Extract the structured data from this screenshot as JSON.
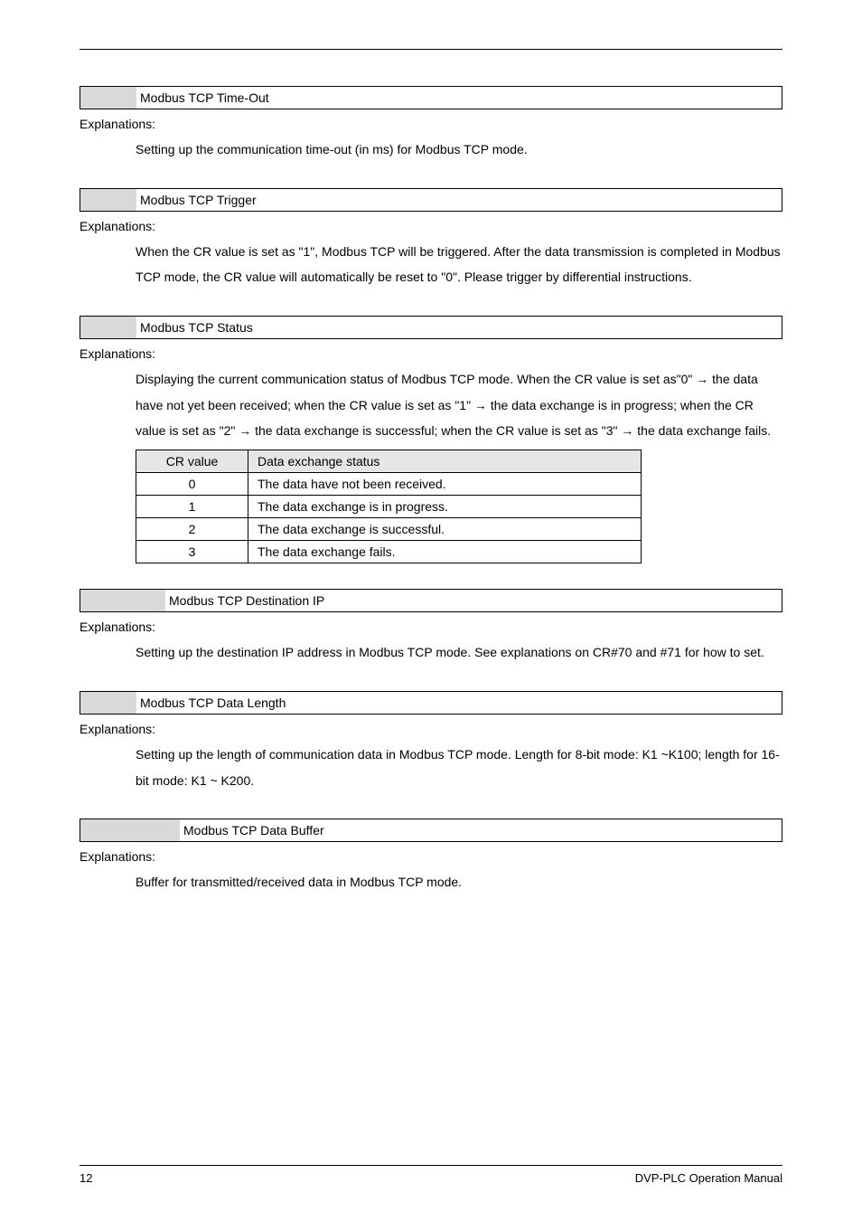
{
  "sections": {
    "timeout": {
      "title": "Modbus TCP Time-Out",
      "label": "Explanations:",
      "body": "Setting up the communication time-out (in ms) for Modbus TCP mode."
    },
    "trigger": {
      "title": "Modbus TCP Trigger",
      "label": "Explanations:",
      "body": "When the CR value is set as \"1\", Modbus TCP will be triggered. After the data transmission is completed in Modbus TCP mode, the CR value will automatically be reset to \"0\". Please trigger by differential instructions."
    },
    "status": {
      "title": "Modbus TCP Status",
      "label": "Explanations:",
      "body": "Displaying the current communication status of Modbus TCP mode. When the CR value is set as\"0\" → the data have not yet been received; when the CR value is set as \"1\" → the data exchange is in progress; when the CR value is set as \"2\" → the data exchange is successful; when the CR value is set as \"3\" → the data exchange fails.",
      "table": {
        "head_cr": "CR value",
        "head_status": "Data exchange status",
        "rows": [
          {
            "cr": "0",
            "status": "The data have not been received."
          },
          {
            "cr": "1",
            "status": "The data exchange is in progress."
          },
          {
            "cr": "2",
            "status": "The data exchange is successful."
          },
          {
            "cr": "3",
            "status": "The data exchange fails."
          }
        ]
      }
    },
    "destip": {
      "title": "Modbus TCP Destination IP",
      "label": "Explanations:",
      "body": "Setting up the destination IP address in Modbus TCP mode. See explanations on CR#70 and #71 for how to set."
    },
    "datalen": {
      "title": "Modbus TCP Data Length",
      "label": "Explanations:",
      "body": "Setting up the length of communication data in Modbus TCP mode. Length for 8-bit mode: K1 ~K100; length for 16-bit mode: K1 ~ K200."
    },
    "databuf": {
      "title": "Modbus TCP Data Buffer",
      "label": "Explanations:",
      "body": "Buffer for transmitted/received data in Modbus TCP mode."
    }
  },
  "footer": {
    "page": "12",
    "manual": "DVP-PLC Operation Manual"
  }
}
